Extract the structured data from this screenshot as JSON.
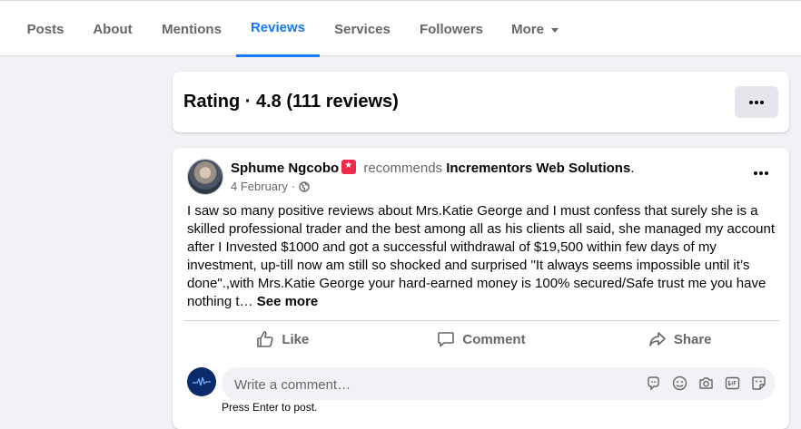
{
  "nav": {
    "tabs": [
      "Posts",
      "About",
      "Mentions",
      "Reviews",
      "Services",
      "Followers",
      "More"
    ],
    "active": "Reviews"
  },
  "rating": {
    "title": "Rating · 4.8 (111 reviews)"
  },
  "post": {
    "author": "Sphume Ngcobo",
    "verb": "recommends",
    "page": "Incrementors Web Solutions",
    "date": "4 February",
    "date_sep": "·",
    "text": "I saw so many positive reviews about  Mrs.Katie George and I must confess that surely she is a skilled professional trader and the best among all as his clients all said, she managed my account after I Invested $1000 and got a successful withdrawal of $19,500 within few days of my investment, up-till now am still so shocked and surprised \"It always seems impossible until it’s done\".,with  Mrs.Katie George your hard-earned money is 100% secured/Safe trust me you have nothing t…",
    "see_more": "See more",
    "actions": {
      "like": "Like",
      "comment": "Comment",
      "share": "Share"
    }
  },
  "comment": {
    "placeholder": "Write a comment…",
    "hint": "Press Enter to post."
  },
  "icons": {
    "more": "chevron-down-icon",
    "options": "three-dots-icon",
    "audience": "globe-icon",
    "like": "thumbs-up-icon",
    "comment": "speech-bubble-icon",
    "share": "share-arrow-icon",
    "avatar_badge": "star-badge-icon",
    "comment_tools": [
      "avatar-sticker-icon",
      "emoji-icon",
      "camera-icon",
      "gif-icon",
      "sticker-icon"
    ]
  },
  "colors": {
    "accent": "#1877f2",
    "badge": "#f02849",
    "muted": "#65676b",
    "background": "#f0f2f5"
  }
}
